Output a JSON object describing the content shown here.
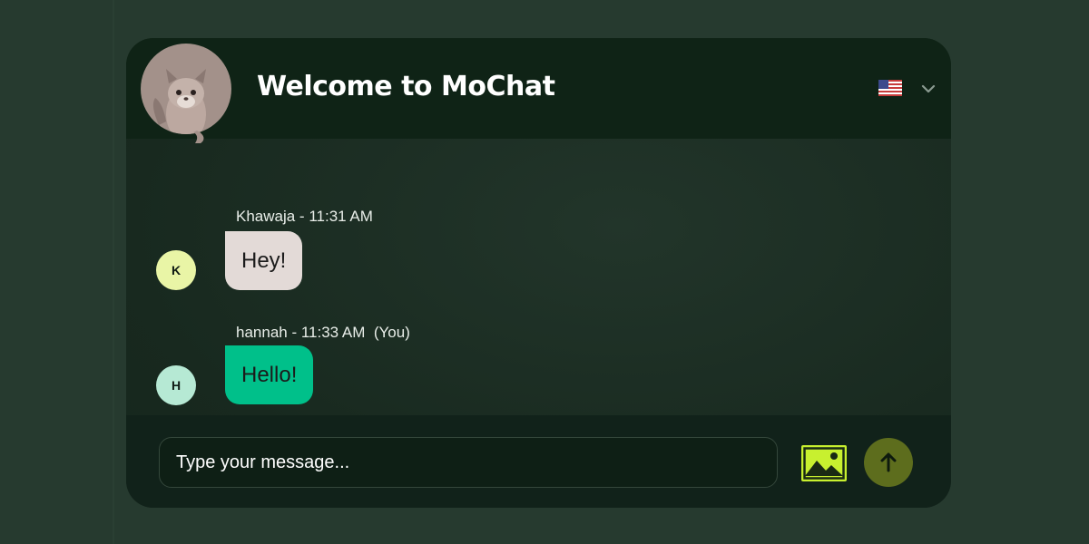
{
  "header": {
    "title": "Welcome to MoChat",
    "mascot_icon": "squirrel-mascot-icon",
    "language_flag_icon": "us-flag-icon",
    "dropdown_icon": "chevron-down-icon"
  },
  "messages": [
    {
      "meta": "Khawaja - 11:31 AM",
      "avatar_initial": "K",
      "avatar_color": "#e9f5a6",
      "text": "Hey!",
      "bubble_color": "#e3dad7"
    },
    {
      "meta": "hannah - 11:33 AM  (You)",
      "avatar_initial": "H",
      "avatar_color": "#b6e9d4",
      "text": "Hello!",
      "bubble_color": "#00c08a"
    }
  ],
  "composer": {
    "placeholder": "Type your message...",
    "image_icon": "image-icon",
    "send_icon": "arrow-up-icon"
  },
  "colors": {
    "page_background": "#263a2f",
    "header_background": "#0f2316",
    "accent_lime": "#c8f02f",
    "send_button": "#5d6d1d"
  }
}
